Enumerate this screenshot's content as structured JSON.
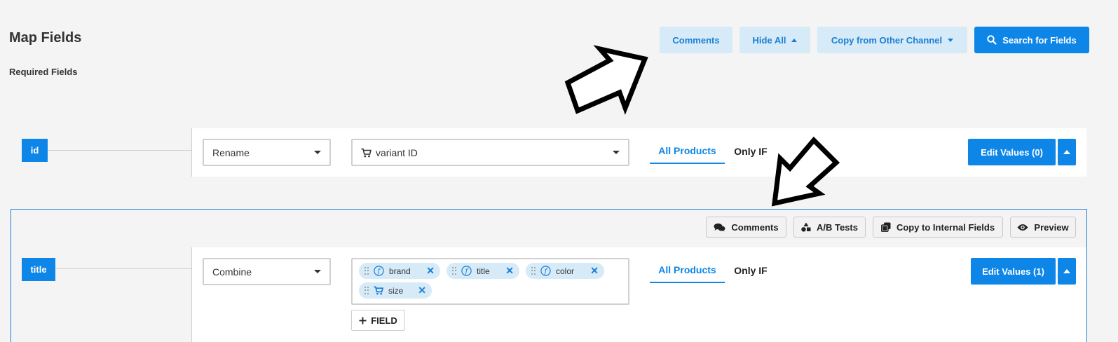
{
  "header": {
    "title": "Map Fields",
    "subtitle": "Required Fields"
  },
  "toolbar": {
    "comments_label": "Comments",
    "hide_all_label": "Hide All",
    "copy_channel_label": "Copy from Other Channel",
    "search_fields_label": "Search for Fields"
  },
  "rows": [
    {
      "field": "id",
      "operation": "Rename",
      "source": "variant ID",
      "tab_all": "All Products",
      "tab_only": "Only IF",
      "edit_label": "Edit Values (0)"
    },
    {
      "field": "title",
      "operation": "Combine",
      "chips": [
        "brand",
        "title",
        "color",
        "size"
      ],
      "add_field_label": "FIELD",
      "tab_all": "All Products",
      "tab_only": "Only IF",
      "edit_label": "Edit Values (1)"
    }
  ],
  "title_toolbar": {
    "comments_label": "Comments",
    "ab_tests_label": "A/B Tests",
    "copy_internal_label": "Copy to Internal Fields",
    "preview_label": "Preview"
  },
  "colors": {
    "accent": "#0e86e8",
    "accent_light": "#d6eaf8",
    "background": "#f4f4f4"
  },
  "icons": [
    "search-icon",
    "cart-icon",
    "function-icon",
    "comments-icon",
    "shapes-icon",
    "copy-icon",
    "eye-icon",
    "plus-icon",
    "close-icon"
  ]
}
